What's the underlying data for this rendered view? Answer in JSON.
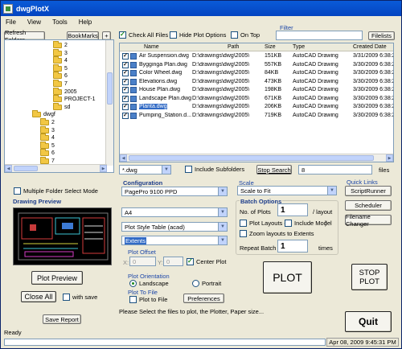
{
  "window": {
    "title": "dwgPlotX"
  },
  "menu": [
    "File",
    "View",
    "Tools",
    "Help"
  ],
  "toolbar": {
    "refresh_folders": "Refresh Folders",
    "bookmarks": "BookMarks",
    "plus": "+",
    "check_all_files": "Check All Files",
    "hide_plot_options": "Hide Plot Options",
    "on_top": "On Top",
    "filter_label": "Filter",
    "filter_value": "",
    "filelists": "Filelists"
  },
  "tree": {
    "items": [
      {
        "label": "2"
      },
      {
        "label": "3"
      },
      {
        "label": "4"
      },
      {
        "label": "5"
      },
      {
        "label": "6"
      },
      {
        "label": "7"
      },
      {
        "label": "2005"
      },
      {
        "label": "PROJECT-1"
      },
      {
        "label": "sd"
      },
      {
        "label": "dwgf"
      },
      {
        "label": "2"
      },
      {
        "label": "3"
      },
      {
        "label": "4"
      },
      {
        "label": "5"
      },
      {
        "label": "6"
      },
      {
        "label": "7"
      }
    ]
  },
  "files": {
    "columns": [
      "Name",
      "Path",
      "Size",
      "Type",
      "Created Date"
    ],
    "rows": [
      {
        "name": "Air Suspension.dwg",
        "path": "D:\\drawings\\dwg\\2005\\",
        "size": "151KB",
        "type": "AutoCAD Drawing",
        "date": "3/31/2009 6:38:2"
      },
      {
        "name": "Bygginga Plan.dwg",
        "path": "D:\\drawings\\dwg\\2005\\",
        "size": "557KB",
        "type": "AutoCAD Drawing",
        "date": "3/30/2009 6:38:2"
      },
      {
        "name": "Color Wheel.dwg",
        "path": "D:\\drawings\\dwg\\2005\\",
        "size": "84KB",
        "type": "AutoCAD Drawing",
        "date": "3/30/2009 6:38:2"
      },
      {
        "name": "Elevations.dwg",
        "path": "D:\\drawings\\dwg\\2005\\",
        "size": "473KB",
        "type": "AutoCAD Drawing",
        "date": "3/30/2009 6:38:2"
      },
      {
        "name": "House Plan.dwg",
        "path": "D:\\drawings\\dwg\\2005\\",
        "size": "198KB",
        "type": "AutoCAD Drawing",
        "date": "3/30/2009 6:38:2"
      },
      {
        "name": "Landscape Plan.dwg",
        "path": "D:\\drawings\\dwg\\2005\\",
        "size": "671KB",
        "type": "AutoCAD Drawing",
        "date": "3/30/2009 6:38:2"
      },
      {
        "name": "Planta.dwg",
        "path": "D:\\drawings\\dwg\\2005\\",
        "size": "206KB",
        "type": "AutoCAD Drawing",
        "date": "3/30/2009 6:38:2"
      },
      {
        "name": "Pumping_Station.d...",
        "path": "D:\\drawings\\dwg\\2005\\",
        "size": "719KB",
        "type": "AutoCAD Drawing",
        "date": "3/30/2009 6:38:2"
      }
    ]
  },
  "search": {
    "ext": "*.dwg",
    "include_subfolders": "Include Subfolders",
    "stop_search": "Stop Search",
    "count": "8",
    "files_label": "files"
  },
  "left": {
    "multiple_folder": "Multiple Folder Select Mode",
    "drawing_preview": "Drawing Preview",
    "plot_preview": "Plot Preview",
    "close_all": "Close All",
    "with_save": "with save",
    "save_report": "Save Report"
  },
  "config": {
    "label": "Configuration",
    "plotter": "PagePro 9100 PPD",
    "paper": "A4",
    "plot_style": "Plot Style Table (acad)",
    "area": "Extents",
    "plot_offset": "Plot Offset",
    "x_label": "X:",
    "x_value": "0",
    "y_label": "Y:",
    "y_value": "0",
    "center_plot": "Center Plot",
    "plot_orientation": "Plot Orientation",
    "landscape": "Landscape",
    "portrait": "Portrait",
    "plot_to_file_group": "Plot To File",
    "plot_to_file": "Plot to File",
    "preferences": "Preferences"
  },
  "scale": {
    "label": "Scale",
    "value": "Scale to Fit",
    "batch_options": "Batch Options",
    "no_of_plots": "No. of Plots",
    "plots_value": "1",
    "per_layout": "/ layout",
    "plot_layouts": "Plot Layouts (",
    "include_model": "Include Model",
    "close_paren": ")",
    "zoom_layouts": "Zoom layouts to Extents",
    "repeat_batch": "Repeat Batch",
    "repeat_value": "1",
    "times": "times"
  },
  "actions": {
    "plot": "PLOT",
    "stop_plot_1": "STOP",
    "stop_plot_2": "PLOT",
    "quit": "Quit"
  },
  "quick_links": {
    "label": "Quick Links",
    "scriptrunner": "ScriptRunner",
    "scheduler": "Scheduler",
    "filename_changer": "Filename Changer"
  },
  "status": {
    "message": "Please Select the files to plot, the Plotter, Paper size...",
    "ready": "Ready",
    "datetime": "Apr 08, 2009   9:45:31 PM"
  }
}
